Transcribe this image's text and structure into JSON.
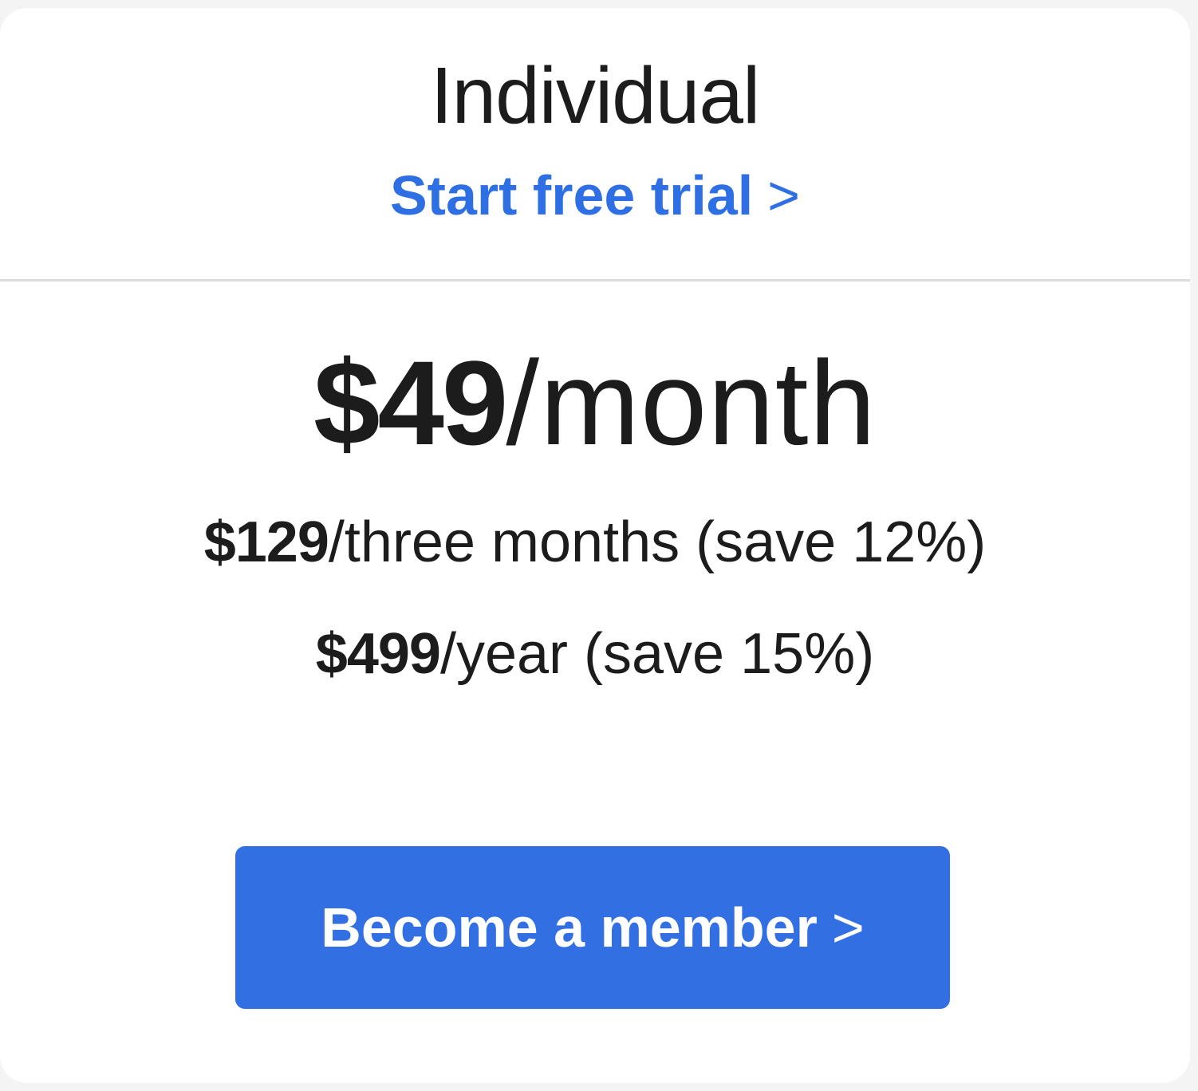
{
  "plan": {
    "title": "Individual",
    "trial_label": "Start free trial",
    "trial_chevron": ">",
    "accent_color": "#2f6fe4"
  },
  "pricing": {
    "monthly": {
      "amount": "$49",
      "period": "/month"
    },
    "quarterly": {
      "amount": "$129",
      "period": "/three months (save 12%)"
    },
    "yearly": {
      "amount": "$499",
      "period": "/year (save 15%)"
    }
  },
  "cta": {
    "label": "Become a member",
    "chevron": ">",
    "color": "#316fe3"
  }
}
